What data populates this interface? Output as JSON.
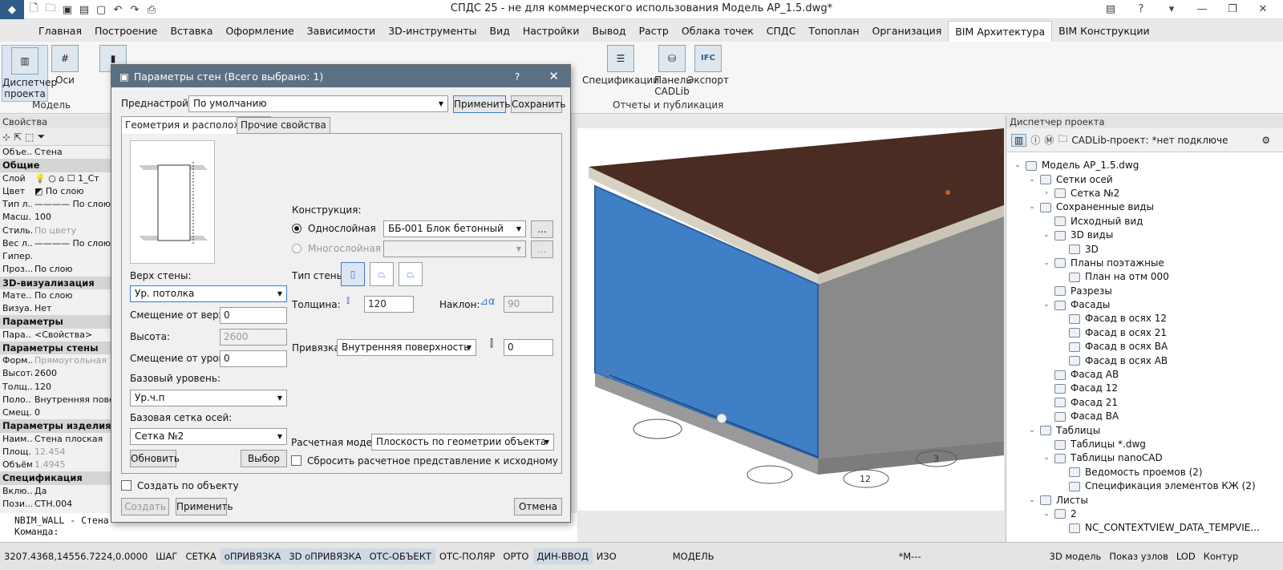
{
  "app": {
    "title": "СПДС 25 - не для коммерческого использования Модель АР_1.5.dwg*"
  },
  "menu": [
    "Главная",
    "Построение",
    "Вставка",
    "Оформление",
    "Зависимости",
    "3D-инструменты",
    "Вид",
    "Настройки",
    "Вывод",
    "Растр",
    "Облака точек",
    "СПДС",
    "Топоплан",
    "Организация",
    "BIM Архитектура",
    "BIM Конструкции"
  ],
  "ribbon": {
    "dispatcher": "Диспетчер проекта",
    "axes": "Оси",
    "group_model": "Модель",
    "specs": "Спецификации",
    "panel": "Панель CADLib",
    "export": "Экспорт",
    "group_reports": "Отчеты и публикация",
    "ifc": "IFC"
  },
  "properties": {
    "title": "Свойства",
    "rows": [
      {
        "type": "row",
        "k": "Объе...",
        "v": "Стена"
      },
      {
        "type": "sec",
        "k": "Общие"
      },
      {
        "type": "row",
        "k": "Слой",
        "v": "💡 ○ ⌂ ☐ 1_Ст"
      },
      {
        "type": "row",
        "k": "Цвет",
        "v": "◩ По слою"
      },
      {
        "type": "row",
        "k": "Тип л...",
        "v": "———— По слою"
      },
      {
        "type": "row",
        "k": "Масш...",
        "v": "100"
      },
      {
        "type": "row",
        "k": "Стиль...",
        "v": "По цвету",
        "gray": true
      },
      {
        "type": "row",
        "k": "Вес л...",
        "v": "———— По слою"
      },
      {
        "type": "row",
        "k": "Гипер...",
        "v": ""
      },
      {
        "type": "row",
        "k": "Проз...",
        "v": "По слою"
      },
      {
        "type": "sec",
        "k": "3D-визуализация"
      },
      {
        "type": "row",
        "k": "Мате...",
        "v": "По слою"
      },
      {
        "type": "row",
        "k": "Визуа...",
        "v": "Нет"
      },
      {
        "type": "sec",
        "k": "Параметры"
      },
      {
        "type": "row",
        "k": "Пара...",
        "v": "<Свойства>"
      },
      {
        "type": "sec",
        "k": "Параметры стены"
      },
      {
        "type": "row",
        "k": "Форм...",
        "v": "Прямоугольная",
        "gray": true
      },
      {
        "type": "row",
        "k": "Высота",
        "v": "2600"
      },
      {
        "type": "row",
        "k": "Толщ...",
        "v": "120"
      },
      {
        "type": "row",
        "k": "Поло...",
        "v": "Внутренняя поверхн"
      },
      {
        "type": "row",
        "k": "Смещ...",
        "v": "0"
      },
      {
        "type": "sec",
        "k": "Параметры изделия"
      },
      {
        "type": "row",
        "k": "Наим...",
        "v": "Стена плоская"
      },
      {
        "type": "row",
        "k": "Площ...",
        "v": "12.454",
        "gray": true
      },
      {
        "type": "row",
        "k": "Объём",
        "v": "1.4945",
        "gray": true
      },
      {
        "type": "sec",
        "k": "Спецификация"
      },
      {
        "type": "row",
        "k": "Вклю...",
        "v": "Да"
      },
      {
        "type": "row",
        "k": "Пози...",
        "v": "СТН.004"
      }
    ]
  },
  "command": {
    "line1": "NBIM_WALL - Стена",
    "line2": "Команда:"
  },
  "status": {
    "coords": "3207.4368,14556.7224,0.0000",
    "toggles": [
      {
        "label": "ШАГ",
        "on": false
      },
      {
        "label": "СЕТКА",
        "on": false
      },
      {
        "label": "оПРИВЯЗКА",
        "on": true
      },
      {
        "label": "3D оПРИВЯЗКА",
        "on": true
      },
      {
        "label": "ОТС-ОБЪЕКТ",
        "on": true
      },
      {
        "label": "ОТС-ПОЛЯР",
        "on": false
      },
      {
        "label": "ОРТО",
        "on": false
      },
      {
        "label": "ДИН-ВВОД",
        "on": true
      },
      {
        "label": "ИЗО",
        "on": false
      }
    ],
    "model": "МОДЕЛЬ",
    "scale": "*М---",
    "model3d": "3D модель",
    "nodes": "Показ узлов",
    "lod": "LOD",
    "contour": "Контур"
  },
  "dialog": {
    "title": "Параметры стен (Всего выбрано: 1)",
    "presets_label": "Преднастройки:",
    "presets_value": "По умолчанию",
    "apply_btn": "Применить",
    "save_btn": "Сохранить",
    "tab_geom": "Геометрия и расположение",
    "tab_other": "Прочие свойства",
    "construction_label": "Конструкция:",
    "single_layer": "Однослойная",
    "multi_layer": "Многослойная",
    "material": "ББ-001 Блок бетонный",
    "wall_type_label": "Тип стены:",
    "thickness_label": "Толщина:",
    "thickness_value": "120",
    "slope_label": "Наклон:",
    "slope_value": "90",
    "wall_top_label": "Верх стены:",
    "wall_top_value": "Ур. потолка",
    "offset_top_label": "Смещение от верха:",
    "offset_top_value": "0",
    "height_label": "Высота:",
    "height_value": "2600",
    "offset_level_label": "Смещение от уровня:",
    "offset_level_value": "0",
    "base_level_label": "Базовый уровень:",
    "base_level_value": "Ур.ч.п",
    "base_grid_label": "Базовая сетка осей:",
    "base_grid_value": "Сетка №2",
    "refresh_btn": "Обновить",
    "select_btn": "Выбор",
    "snap_label": "Привязка:",
    "snap_value": "Внутренняя поверхность",
    "snap_offset": "0",
    "calc_model_label": "Расчетная модель:",
    "calc_model_value": "Плоскость по геометрии объекта",
    "reset_calc": "Сбросить расчетное представление к исходному",
    "create_by_object": "Создать по объекту",
    "create_btn": "Создать",
    "apply2_btn": "Применить",
    "cancel_btn": "Отмена",
    "help": "?",
    "close": "✕",
    "ellipsis": "..."
  },
  "project_manager": {
    "title": "Диспетчер проекта",
    "cadlib": "CADLib-проект: *нет подключе",
    "tree": [
      {
        "lvl": 0,
        "exp": "⌄",
        "label": "Модель АР_1.5.dwg"
      },
      {
        "lvl": 1,
        "exp": "⌄",
        "label": "Сетки осей"
      },
      {
        "lvl": 2,
        "exp": "›",
        "label": "Сетка №2"
      },
      {
        "lvl": 1,
        "exp": "⌄",
        "label": "Сохраненные виды"
      },
      {
        "lvl": 2,
        "exp": "",
        "label": "Исходный вид"
      },
      {
        "lvl": 2,
        "exp": "⌄",
        "label": "3D виды"
      },
      {
        "lvl": 3,
        "exp": "",
        "label": "3D"
      },
      {
        "lvl": 2,
        "exp": "⌄",
        "label": "Планы поэтажные"
      },
      {
        "lvl": 3,
        "exp": "",
        "label": "План на отм 000"
      },
      {
        "lvl": 2,
        "exp": "",
        "label": "Разрезы"
      },
      {
        "lvl": 2,
        "exp": "⌄",
        "label": "Фасады"
      },
      {
        "lvl": 3,
        "exp": "",
        "label": "Фасад в осях 12"
      },
      {
        "lvl": 3,
        "exp": "",
        "label": "Фасад в осях 21"
      },
      {
        "lvl": 3,
        "exp": "",
        "label": "Фасад в осях ВА"
      },
      {
        "lvl": 3,
        "exp": "",
        "label": "Фасад в осях АВ"
      },
      {
        "lvl": 2,
        "exp": "",
        "label": "Фасад АВ"
      },
      {
        "lvl": 2,
        "exp": "",
        "label": "Фасад 12"
      },
      {
        "lvl": 2,
        "exp": "",
        "label": "Фасад 21"
      },
      {
        "lvl": 2,
        "exp": "",
        "label": "Фасад ВА"
      },
      {
        "lvl": 1,
        "exp": "⌄",
        "label": "Таблицы"
      },
      {
        "lvl": 2,
        "exp": "",
        "label": "Таблицы *.dwg"
      },
      {
        "lvl": 2,
        "exp": "⌄",
        "label": "Таблицы nanoCAD"
      },
      {
        "lvl": 3,
        "exp": "",
        "label": "Ведомость проемов (2)"
      },
      {
        "lvl": 3,
        "exp": "",
        "label": "Спецификация элементов КЖ (2)"
      },
      {
        "lvl": 1,
        "exp": "⌄",
        "label": "Листы"
      },
      {
        "lvl": 2,
        "exp": "⌄",
        "label": "2"
      },
      {
        "lvl": 3,
        "exp": "",
        "label": "NC_CONTEXTVIEW_DATA_TEMPVIE..."
      }
    ]
  },
  "viewport": {
    "axis_labels": [
      "12",
      "3"
    ]
  },
  "colors": {
    "wall_selected": "#3f7fc6",
    "roof": "#4a2c22",
    "dialog_title": "#5b7183",
    "status_on": "#cfd9e6"
  }
}
